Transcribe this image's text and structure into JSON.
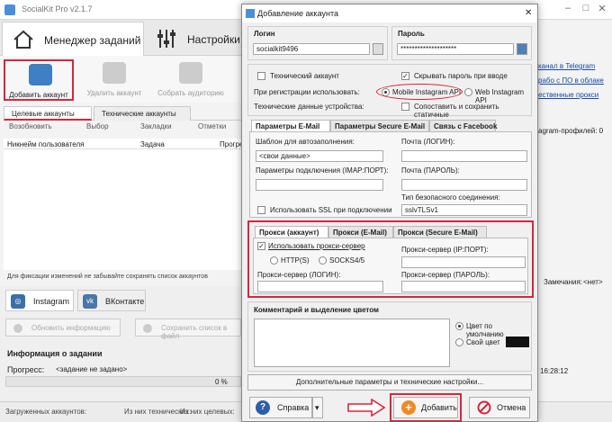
{
  "app": {
    "title": "SocialKit Pro v2.1.7"
  },
  "main_tabs": [
    {
      "label": "Менеджер заданий"
    },
    {
      "label": "Настройки"
    }
  ],
  "toolbar": {
    "add_account": "Добавить аккаунт",
    "delete_account": "Удалить аккаунт",
    "collect_audience": "Собрать аудиторию"
  },
  "sub_tabs": [
    {
      "label": "Целевые аккаунты"
    },
    {
      "label": "Технические аккаунты"
    }
  ],
  "filters": {
    "resume": "Возобновить",
    "select": "Выбор",
    "bookmarks": "Закладки",
    "marks": "Отметки"
  },
  "grid": {
    "columns": [
      "Никнейм пользователя",
      "Задача",
      "Прогре"
    ]
  },
  "fix_note": "Для фиксации изменений не забывайте сохранять список аккаунтов",
  "networks": [
    {
      "label": "Instagram"
    },
    {
      "label": "ВКонтакте"
    }
  ],
  "actions": {
    "update_info": "Обновить информацию",
    "save_list": "Сохранить список в файл"
  },
  "task_info": {
    "title": "Информация о задании",
    "progress_label": "Прогресс:",
    "progress_value": "<задание не задано>",
    "percent": "0 %"
  },
  "status": {
    "loaded": "Загруженных аккаунтов:",
    "technical": "Из них технических:",
    "targets": "Из них целевых:"
  },
  "right": {
    "telegram": "канал в Telegram",
    "ad_cloud": "рабо с ПО в облаке",
    "proxy": "ественные прокси",
    "profiles": "agram-профилей: 0",
    "remarks": "Замечания:",
    "remarks_value": "<нет>",
    "time": "16:28:12"
  },
  "dialog": {
    "title": "Добавление аккаунта",
    "login_label": "Логин",
    "login_value": "socialkit9496",
    "password_label": "Пароль",
    "password_value": "********************",
    "tech_account": "Технический аккаунт",
    "hide_password": "Скрывать пароль при вводе",
    "register_using": "При регистрации использовать:",
    "api_mobile": "Mobile Instagram API",
    "api_web": "Web Instagram API",
    "tech_device": "Технические данные устройства:",
    "compare_save": "Сопоставить и сохранить статичные",
    "email_tabs": [
      {
        "label": "Параметры E-Mail"
      },
      {
        "label": "Параметры Secure E-Mail"
      },
      {
        "label": "Связь с Facebook"
      }
    ],
    "template_label": "Шаблон для автозаполнения:",
    "template_value": "<свои данные>",
    "mail_login_label": "Почта (ЛОГИН):",
    "connection_label": "Параметры подключения (IMAP:ПОРТ):",
    "mail_password_label": "Почта (ПАРОЛЬ):",
    "secure_type_label": "Тип безопасного соединения:",
    "secure_type_value": "sslvTLSv1",
    "use_ssl": "Использовать SSL при подключении",
    "proxy_tabs": [
      {
        "label": "Прокси (аккаунт)"
      },
      {
        "label": "Прокси (E-Mail)"
      },
      {
        "label": "Прокси (Secure E-Mail)"
      }
    ],
    "use_proxy": "Использовать прокси-сервер",
    "proxy_http": "HTTP(S)",
    "proxy_socks": "SOCKS4/5",
    "proxy_ip_label": "Прокси-сервер (IP:ПОРТ):",
    "proxy_login_label": "Прокси-сервер (ЛОГИН):",
    "proxy_password_label": "Прокси-сервер (ПАРОЛЬ):",
    "comment_label": "Комментарий и выделение цветом",
    "color_default": "Цвет по умолчанию",
    "color_own": "Свой цвет",
    "advanced": "Дополнительные параметры и технические настройки...",
    "help": "Справка",
    "add": "Добавить",
    "cancel": "Отмена"
  },
  "colors": {
    "accent_red": "#d7263d",
    "instagram": "#3b6fa6",
    "vk": "#4a76a8",
    "add_orange": "#f08a24"
  }
}
